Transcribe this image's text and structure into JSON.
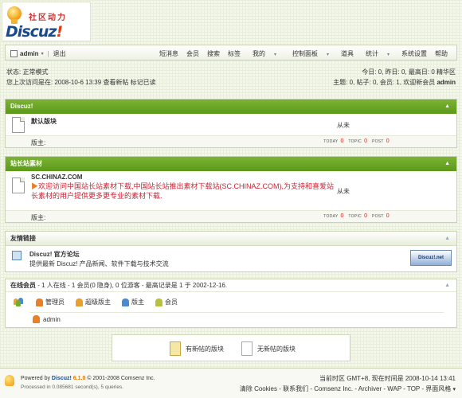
{
  "logo": {
    "cn": "社区动力",
    "name": "Discuz",
    "bang": "!"
  },
  "topbar": {
    "username": "admin",
    "logout": "退出",
    "nav": [
      "短消息",
      "会员",
      "搜索",
      "标签",
      "我的",
      "控制面板",
      "道具",
      "统计",
      "系统设置",
      "帮助"
    ]
  },
  "status": {
    "mode": "状态: 正常模式",
    "last_visit": "您上次访问是在: 2008-10-6 13:39 查看新帖  标记已读"
  },
  "stats": {
    "today": "今日: 0, 昨日: 0, 最高日: 0  精华区",
    "totals": "主题: 0, 帖子: 0, 会员: 1, 欢迎新会员",
    "newest_member": "admin"
  },
  "sections": [
    {
      "title": "Discuz!",
      "forum_name": "默认版块",
      "last_post": "从未",
      "moderator_label": "版主:",
      "today_label": "TODAY",
      "today": "0",
      "topic_label": "TOPIC",
      "topic": "0",
      "post_label": "POST",
      "post": "0"
    },
    {
      "title": "站长站素材",
      "forum_name": "SC.CHINAZ.COM",
      "desc_arrow": "▶",
      "description": "欢迎访问中国站长站素材下载,中国站长站推出素材下载站(SC.CHINAZ.COM),为支持和喜爱站长素材的用户提供更多更专业的素材下载.",
      "last_post": "从未",
      "moderator_label": "版主:",
      "today_label": "TODAY",
      "today": "0",
      "topic_label": "TOPIC",
      "topic": "0",
      "post_label": "POST",
      "post": "0"
    }
  ],
  "links": {
    "title": "友情链接",
    "site_name": "Discuz! 官方论坛",
    "site_desc": "提供最新 Discuz! 产品新闻、软件下载与技术交流",
    "badge": "Discuz!.net"
  },
  "online": {
    "title": "在线会员",
    "summary": "- 1 人在线 - 1 会员(0 隐身), 0 位游客 - 最高记录是 1 于 2002-12-16.",
    "legend": [
      "管理员",
      "超级版主",
      "版主",
      "会员"
    ],
    "users": [
      "admin"
    ]
  },
  "new_posts": {
    "has_new": "有新帖的版块",
    "no_new": "无新帖的版块"
  },
  "footer": {
    "powered": "Powered by",
    "brand": "Discuz!",
    "version": "6.1.0",
    "copyright": "© 2001-2008 Comsenz Inc.",
    "processed": "Processed in 0.085681 second(s), 5 queries.",
    "time": "当前时区 GMT+8, 现在时间是 2008-10-14 13:41",
    "links": "清除 Cookies - 联系我们 - Comsenz Inc. - Archiver - WAP - TOP - 界面风格",
    "caret": "▾"
  },
  "colors": {
    "header_green": "#6aa726",
    "accent_red": "#dd2222",
    "brand_blue": "#1a4a8c"
  }
}
